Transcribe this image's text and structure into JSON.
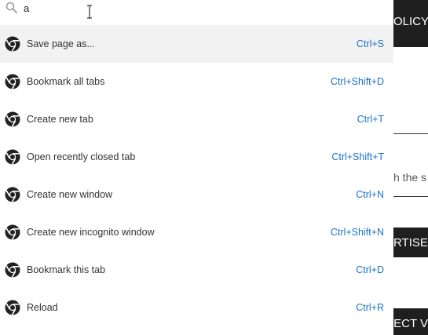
{
  "search": {
    "value": "a"
  },
  "commands": [
    {
      "label": "Save page as...",
      "shortcut": "Ctrl+S",
      "selected": true
    },
    {
      "label": "Bookmark all tabs",
      "shortcut": "Ctrl+Shift+D",
      "selected": false
    },
    {
      "label": "Create new tab",
      "shortcut": "Ctrl+T",
      "selected": false
    },
    {
      "label": "Open recently closed tab",
      "shortcut": "Ctrl+Shift+T",
      "selected": false
    },
    {
      "label": "Create new window",
      "shortcut": "Ctrl+N",
      "selected": false
    },
    {
      "label": "Create new incognito window",
      "shortcut": "Ctrl+Shift+N",
      "selected": false
    },
    {
      "label": "Bookmark this tab",
      "shortcut": "Ctrl+D",
      "selected": false
    },
    {
      "label": "Reload",
      "shortcut": "Ctrl+R",
      "selected": false
    }
  ],
  "background_page": {
    "policy_fragment": "OLICY",
    "text_fragment": "h the s",
    "advertise_fragment": "RTISE",
    "connect_fragment": "CONNECT V"
  },
  "icons": {
    "command_icon": "chrome-icon",
    "search": "search-icon",
    "text_cursor": "text-cursor-icon"
  },
  "colors": {
    "shortcut": "#1a73c8",
    "selected_row": "#f2f2f2",
    "dark_band": "#1f1f1f"
  }
}
